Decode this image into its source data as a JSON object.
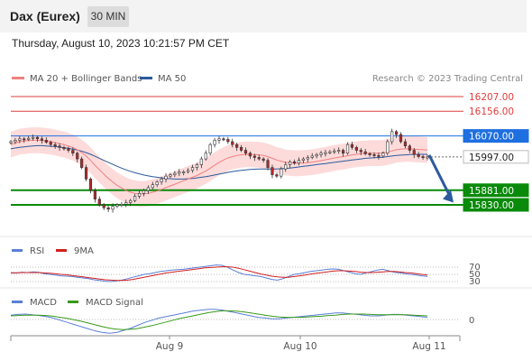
{
  "header": {
    "instrument": "Dax (Eurex)",
    "interval": "30 MIN"
  },
  "timestamp": "Thursday, August 10, 2023 10:21:57 PM CET",
  "legend": {
    "ma20": "MA 20 + Bollinger Bands",
    "ma50": "MA 50",
    "credit": "Research © 2023 Trading Central"
  },
  "colors": {
    "ma20": "#f08080",
    "bollinger_fill": "#fdd5d5",
    "ma50": "#2c5a9c",
    "resistance": "#e03c3c",
    "pivot": "#1e6fe0",
    "support": "#0a8a0a",
    "last_price": "#333333",
    "arrow": "#2c5a9c",
    "rsi": "#5a7fd6",
    "rsi_ma": "#d02020",
    "macd": "#5a7fd6",
    "macd_signal": "#3a9a1a",
    "candle_up": "#ffffff",
    "candle_down": "#b32a2a"
  },
  "chart_data": [
    {
      "type": "candlestick",
      "title": "Dax (Eurex) 30 MIN",
      "levels": [
        {
          "name": "resistance",
          "value": 16207.0,
          "label": "16207.00"
        },
        {
          "name": "resistance",
          "value": 16156.0,
          "label": "16156.00"
        },
        {
          "name": "pivot",
          "value": 16070.0,
          "label": "16070.00"
        },
        {
          "name": "last",
          "value": 15997.0,
          "label": "15997.00"
        },
        {
          "name": "support",
          "value": 15881.0,
          "label": "15881.00"
        },
        {
          "name": "support",
          "value": 15830.0,
          "label": "15830.00"
        }
      ],
      "x_ticks": [
        "Aug 9",
        "Aug 10",
        "Aug 11"
      ],
      "close": [
        16050,
        16055,
        16060,
        16058,
        16062,
        16065,
        16060,
        16055,
        16048,
        16040,
        16035,
        16030,
        16025,
        16020,
        16010,
        15990,
        15960,
        15920,
        15880,
        15850,
        15830,
        15820,
        15815,
        15825,
        15830,
        15832,
        15838,
        15845,
        15860,
        15870,
        15880,
        15890,
        15900,
        15910,
        15920,
        15930,
        15935,
        15940,
        15945,
        15945,
        15950,
        15960,
        15970,
        15990,
        16010,
        16040,
        16055,
        16060,
        16058,
        16050,
        16040,
        16030,
        16020,
        16010,
        16000,
        15995,
        15990,
        15985,
        15960,
        15935,
        15930,
        15955,
        15970,
        15980,
        15975,
        15985,
        15990,
        15995,
        16000,
        16005,
        16010,
        16012,
        16015,
        16018,
        16020,
        16010,
        16040,
        16030,
        16020,
        16015,
        16008,
        16005,
        16002,
        16000,
        16010,
        16050,
        16085,
        16075,
        16050,
        16035,
        16020,
        16005,
        15998,
        15995,
        15997
      ],
      "series": [
        {
          "name": "MA 20",
          "values": [
            16040,
            16045,
            16050,
            16052,
            16054,
            16055,
            16055,
            16054,
            16052,
            16050,
            16047,
            16043,
            16040,
            16035,
            16030,
            16022,
            16012,
            16000,
            15985,
            15968,
            15952,
            15937,
            15922,
            15910,
            15898,
            15889,
            15880,
            15874,
            15870,
            15868,
            15868,
            15870,
            15874,
            15878,
            15884,
            15890,
            15896,
            15902,
            15908,
            15914,
            15920,
            15926,
            15932,
            15940,
            15948,
            15958,
            15968,
            15978,
            15986,
            15993,
            15998,
            16002,
            16004,
            16006,
            16006,
            16005,
            16004,
            16002,
            15998,
            15992,
            15986,
            15982,
            15978,
            15976,
            15975,
            15975,
            15976,
            15977,
            15979,
            15981,
            15984,
            15987,
            15990,
            15993,
            15996,
            15998,
            16001,
            16004,
            16006,
            16008,
            16009,
            16010,
            16010,
            16010,
            16011,
            16014,
            16018,
            16022,
            16024,
            16025,
            16025,
            16024,
            16023,
            16022,
            16021
          ]
        },
        {
          "name": "MA 50",
          "values": [
            16025,
            16028,
            16030,
            16032,
            16034,
            16035,
            16036,
            16036,
            16035,
            16034,
            16033,
            16031,
            16029,
            16027,
            16024,
            16021,
            16017,
            16012,
            16006,
            15999,
            15992,
            15985,
            15978,
            15971,
            15964,
            15958,
            15952,
            15947,
            15942,
            15938,
            15934,
            15931,
            15928,
            15926,
            15924,
            15922,
            15921,
            15920,
            15920,
            15920,
            15921,
            15922,
            15924,
            15926,
            15928,
            15931,
            15934,
            15937,
            15940,
            15943,
            15946,
            15948,
            15950,
            15952,
            15953,
            15954,
            15955,
            15955,
            15955,
            15955,
            15955,
            15956,
            15957,
            15958,
            15960,
            15962,
            15964,
            15966,
            15968,
            15970,
            15972,
            15974,
            15976,
            15978,
            15980,
            15982,
            15984,
            15986,
            15988,
            15990,
            15992,
            15993,
            15994,
            15995,
            15996,
            15998,
            16000,
            16002,
            16003,
            16004,
            16005,
            16006,
            16006,
            16006,
            16006
          ]
        }
      ]
    },
    {
      "type": "line",
      "title": "RSI",
      "y_ticks": [
        70,
        50,
        30
      ],
      "series": [
        {
          "name": "RSI",
          "values": [
            55,
            54,
            56,
            55,
            57,
            56,
            52,
            50,
            48,
            46,
            45,
            44,
            42,
            40,
            38,
            35,
            33,
            31,
            30,
            32,
            34,
            38,
            42,
            46,
            50,
            52,
            55,
            58,
            60,
            62,
            63,
            64,
            66,
            68,
            70,
            72,
            74,
            76,
            75,
            70,
            62,
            55,
            50,
            48,
            46,
            44,
            40,
            36,
            34,
            38,
            44,
            50,
            52,
            55,
            58,
            60,
            62,
            64,
            65,
            64,
            60,
            56,
            52,
            50,
            54,
            58,
            62,
            64,
            60,
            56,
            54,
            52,
            50,
            48,
            46,
            44
          ]
        },
        {
          "name": "9MA",
          "values": [
            54,
            54,
            55,
            55,
            55,
            55,
            54,
            53,
            52,
            50,
            49,
            47,
            45,
            43,
            41,
            39,
            37,
            35,
            34,
            33,
            33,
            34,
            36,
            39,
            42,
            45,
            48,
            51,
            54,
            56,
            58,
            60,
            62,
            64,
            66,
            68,
            69,
            70,
            71,
            71,
            70,
            67,
            63,
            59,
            55,
            51,
            48,
            45,
            43,
            42,
            42,
            44,
            46,
            48,
            51,
            53,
            55,
            57,
            59,
            60,
            60,
            59,
            58,
            56,
            55,
            55,
            56,
            57,
            58,
            58,
            57,
            55,
            54,
            52,
            50,
            48
          ]
        }
      ]
    },
    {
      "type": "line",
      "title": "MACD",
      "y_ticks": [
        0
      ],
      "series": [
        {
          "name": "MACD",
          "values": [
            12,
            14,
            15,
            13,
            11,
            8,
            4,
            -2,
            -8,
            -14,
            -20,
            -26,
            -32,
            -36,
            -38,
            -36,
            -30,
            -24,
            -16,
            -8,
            -2,
            4,
            8,
            12,
            16,
            20,
            24,
            26,
            28,
            28,
            26,
            22,
            18,
            14,
            10,
            6,
            4,
            2,
            2,
            4,
            6,
            8,
            10,
            12,
            14,
            16,
            18,
            18,
            16,
            14,
            12,
            10,
            10,
            12,
            14,
            14,
            12,
            10,
            8,
            6
          ]
        },
        {
          "name": "MACD Signal",
          "values": [
            10,
            11,
            12,
            12,
            12,
            11,
            9,
            6,
            3,
            -1,
            -5,
            -10,
            -15,
            -20,
            -24,
            -27,
            -28,
            -27,
            -25,
            -21,
            -17,
            -12,
            -7,
            -2,
            3,
            7,
            11,
            15,
            19,
            22,
            24,
            24,
            23,
            21,
            18,
            15,
            12,
            9,
            7,
            6,
            6,
            6,
            7,
            8,
            9,
            11,
            12,
            14,
            15,
            15,
            15,
            14,
            13,
            13,
            13,
            13,
            13,
            12,
            11,
            10
          ]
        }
      ]
    }
  ]
}
